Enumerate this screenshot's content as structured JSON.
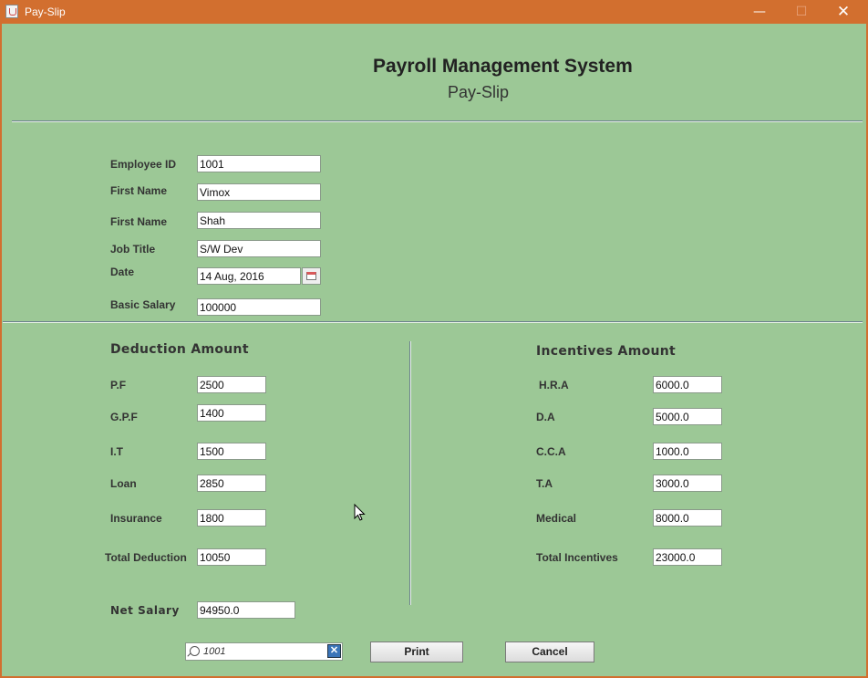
{
  "window": {
    "title": "Pay-Slip"
  },
  "header": {
    "title": "Payroll Management System",
    "subtitle": "Pay-Slip"
  },
  "employee": {
    "id_label": "Employee ID",
    "id": "1001",
    "first_name_label": "First Name",
    "first_name": "Vimox",
    "last_name_label": "First Name",
    "last_name": "Shah",
    "job_title_label": "Job Title",
    "job_title": "S/W Dev",
    "date_label": "Date",
    "date": "14 Aug, 2016",
    "basic_salary_label": "Basic Salary",
    "basic_salary": "100000"
  },
  "deductions": {
    "title": "Deduction Amount",
    "pf_label": "P.F",
    "pf": "2500",
    "gpf_label": "G.P.F",
    "gpf": "1400",
    "it_label": "I.T",
    "it": "1500",
    "loan_label": "Loan",
    "loan": "2850",
    "insurance_label": "Insurance",
    "insurance": "1800",
    "total_label": "Total Deduction",
    "total": "10050"
  },
  "incentives": {
    "title": "Incentives Amount",
    "hra_label": "H.R.A",
    "hra": "6000.0",
    "da_label": "D.A",
    "da": "5000.0",
    "cca_label": "C.C.A",
    "cca": "1000.0",
    "ta_label": "T.A",
    "ta": "3000.0",
    "medical_label": "Medical",
    "medical": "8000.0",
    "total_label": "Total Incentives",
    "total": "23000.0"
  },
  "net": {
    "label": "Net Salary",
    "value": "94950.0"
  },
  "search": {
    "value": "1001"
  },
  "buttons": {
    "print": "Print",
    "cancel": "Cancel"
  }
}
